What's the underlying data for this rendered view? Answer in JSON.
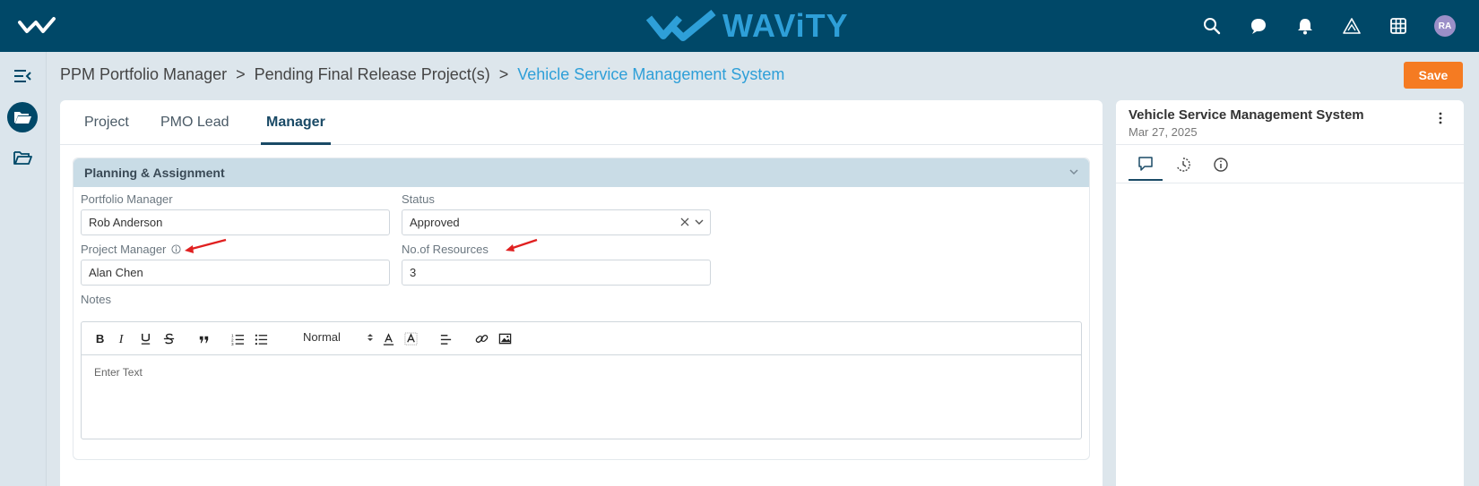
{
  "app": {
    "brand": "WAViTY",
    "user_initials": "RA"
  },
  "colors": {
    "topbar": "#004868",
    "accent": "#2e9fd8",
    "save": "#f57b22",
    "annotation": "#e02020"
  },
  "header_icons": [
    "search-icon",
    "chat-icon",
    "bell-icon",
    "alert-triangle-icon",
    "grid-icon"
  ],
  "breadcrumb": {
    "items": [
      "PPM Portfolio Manager",
      "Pending Final Release Project(s)"
    ],
    "current": "Vehicle Service Management System",
    "separator": ">"
  },
  "toolbar": {
    "save_label": "Save"
  },
  "tabs": [
    {
      "label": "Project",
      "active": false
    },
    {
      "label": "PMO Lead",
      "active": false
    },
    {
      "label": "Manager",
      "active": true
    }
  ],
  "section": {
    "title": "Planning & Assignment",
    "fields": {
      "portfolio_manager": {
        "label": "Portfolio Manager",
        "value": "Rob Anderson"
      },
      "status": {
        "label": "Status",
        "value": "Approved"
      },
      "project_manager": {
        "label": "Project Manager",
        "value": "Alan Chen"
      },
      "resources": {
        "label": "No.of Resources",
        "value": "3"
      }
    },
    "notes": {
      "label": "Notes",
      "placeholder": "Enter Text",
      "format": "Normal",
      "toolbar_icons": [
        "bold-icon",
        "italic-icon",
        "underline-icon",
        "strike-icon",
        "quote-icon",
        "ordered-list-icon",
        "bullet-list-icon",
        "text-color-icon",
        "background-color-icon",
        "align-icon",
        "link-icon",
        "image-icon"
      ]
    }
  },
  "right_panel": {
    "title": "Vehicle Service Management System",
    "date": "Mar 27, 2025",
    "tabs": [
      "comment-icon",
      "history-icon",
      "info-icon"
    ],
    "active_tab": 0
  }
}
